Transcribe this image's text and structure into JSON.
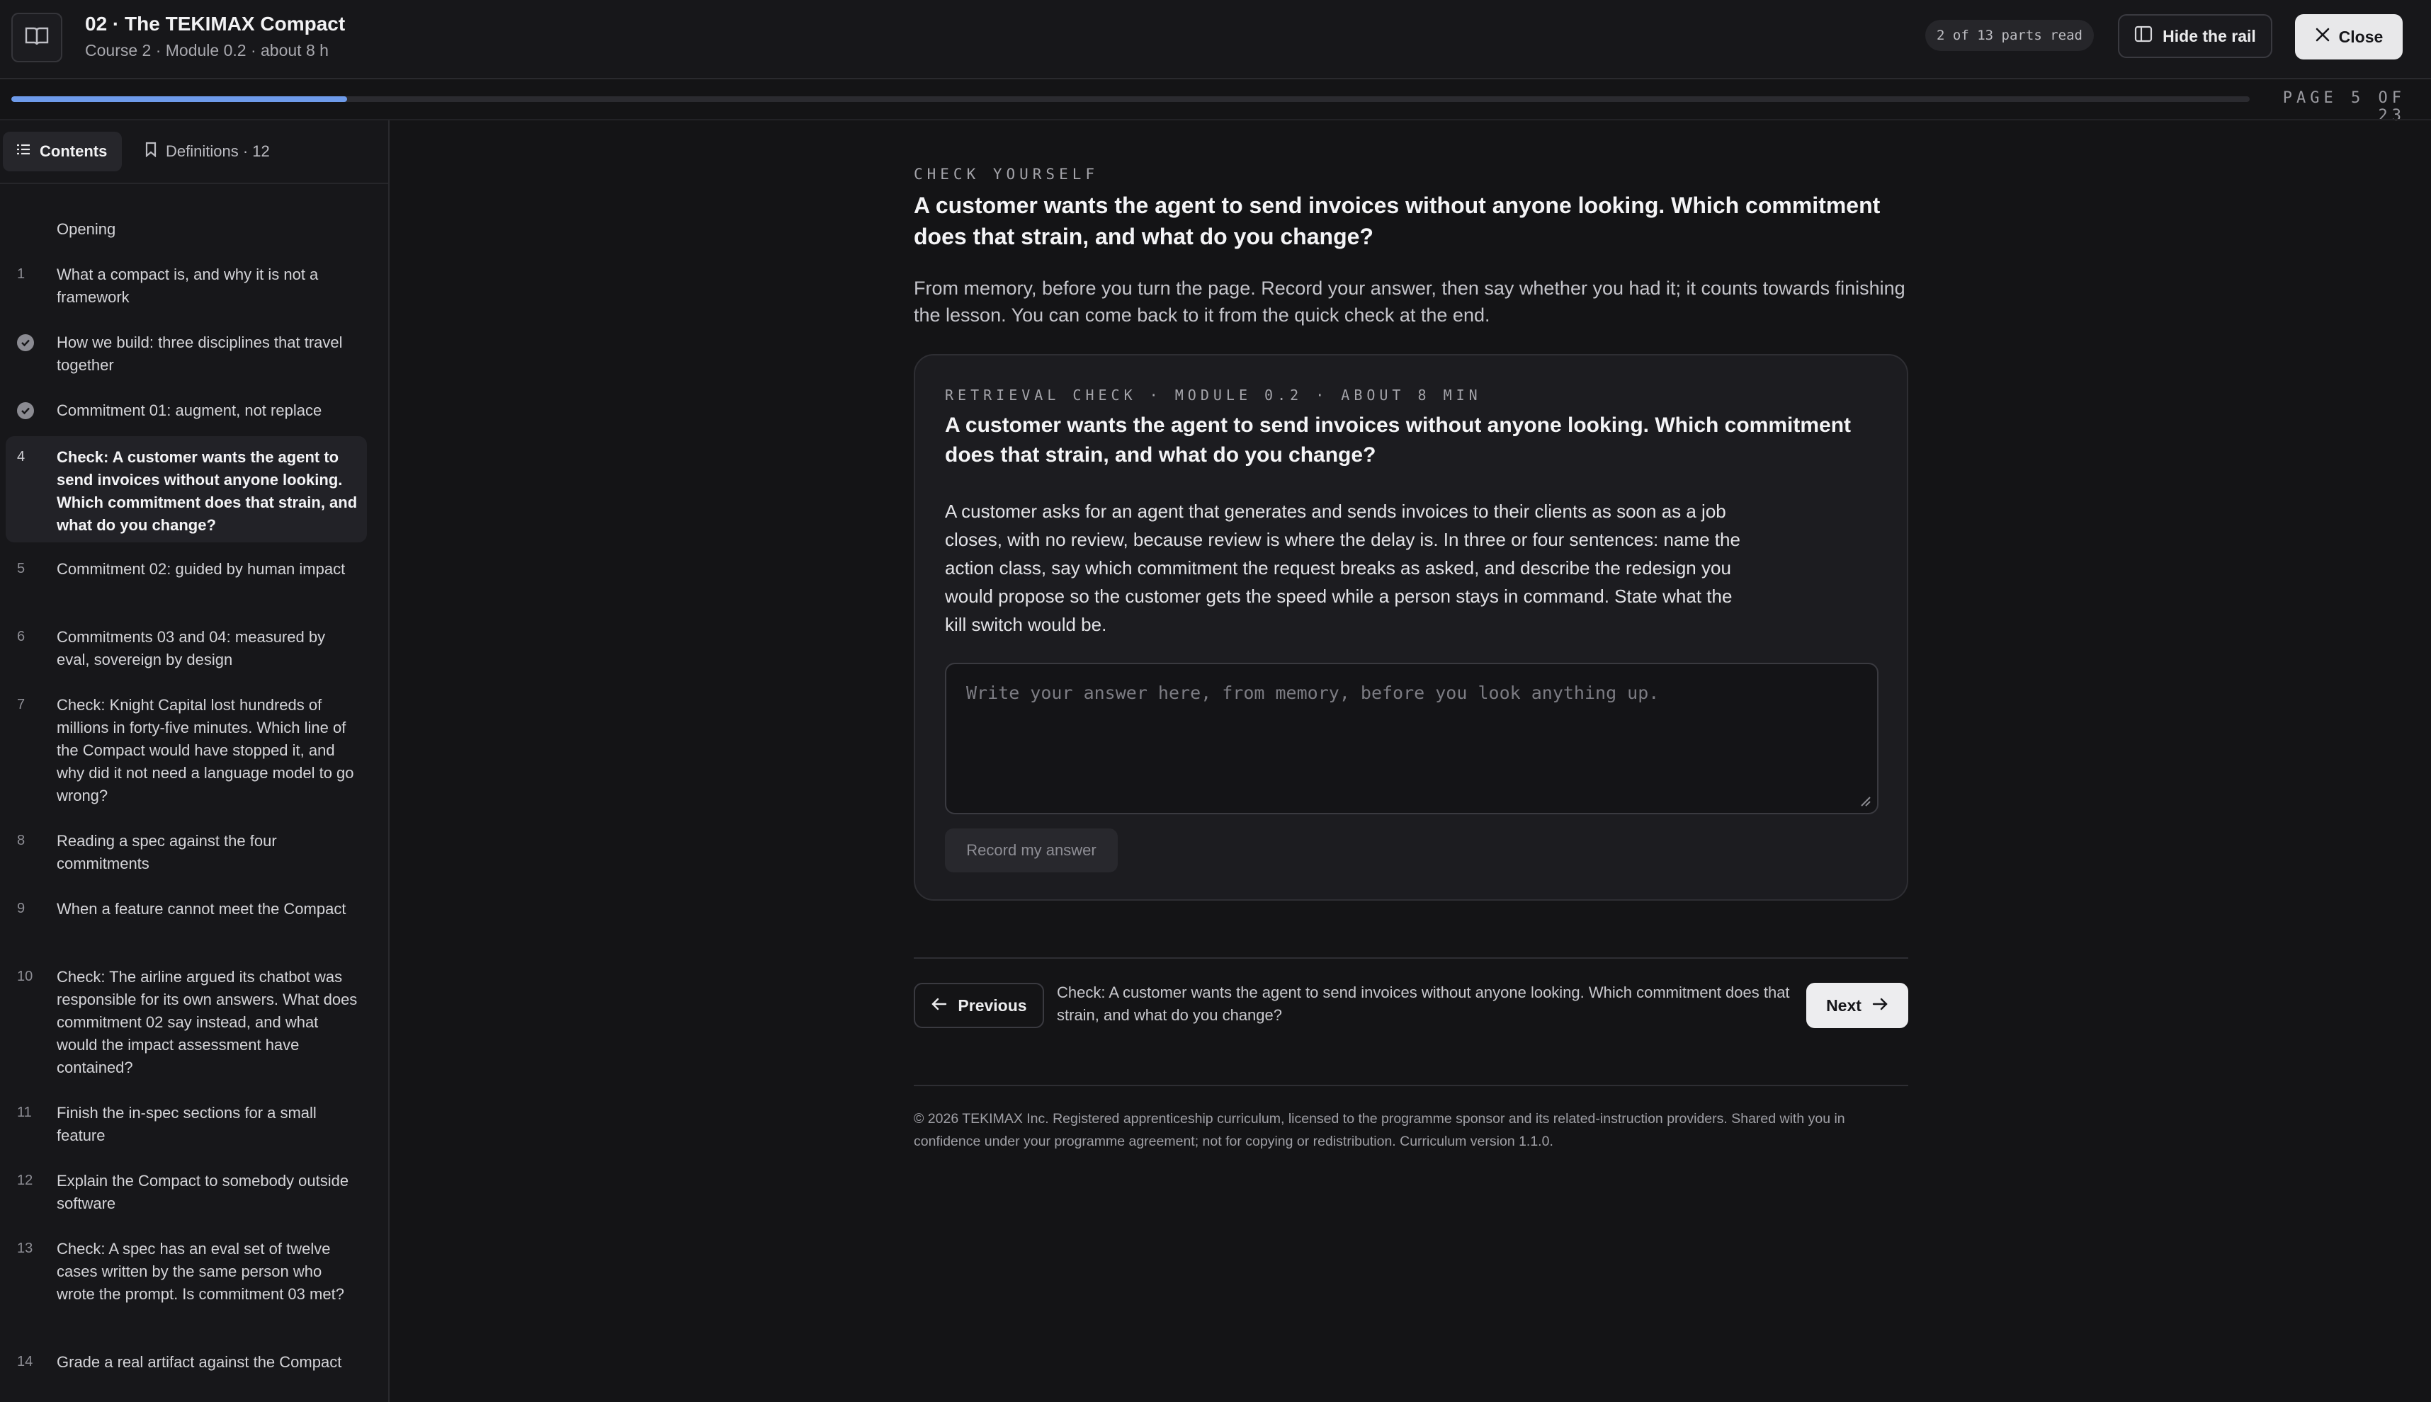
{
  "header": {
    "title": "02 · The TEKIMAX Compact",
    "subtitle": "Course 2 · Module 0.2 · about 8 h",
    "parts_read": "2 of 13 parts read",
    "hide_rail_label": "Hide the rail",
    "close_label": "Close"
  },
  "progress": {
    "fraction": 0.15,
    "page_label": "PAGE 5 OF 23"
  },
  "sidebar": {
    "tabs": [
      {
        "label": "Contents",
        "active": true
      },
      {
        "label": "Definitions · 12",
        "active": false
      }
    ],
    "items": [
      {
        "num": "",
        "label": "Opening",
        "status": "none"
      },
      {
        "num": "1",
        "label": "What a compact is, and why it is not a framework",
        "status": "none"
      },
      {
        "num": "",
        "label": "How we build: three disciplines that travel together",
        "status": "done"
      },
      {
        "num": "",
        "label": "Commitment 01: augment, not replace",
        "status": "done"
      },
      {
        "num": "4",
        "label": "Check: A customer wants the agent to send invoices without anyone looking. Which commitment does that strain, and what do you change?",
        "status": "current"
      },
      {
        "num": "5",
        "label": "Commitment 02: guided by human impact",
        "status": "none"
      },
      {
        "num": "6",
        "label": "Commitments 03 and 04: measured by eval, sovereign by design",
        "status": "none"
      },
      {
        "num": "7",
        "label": "Check: Knight Capital lost hundreds of millions in forty-five minutes. Which line of the Compact would have stopped it, and why did it not need a language model to go wrong?",
        "status": "none"
      },
      {
        "num": "8",
        "label": "Reading a spec against the four commitments",
        "status": "none"
      },
      {
        "num": "9",
        "label": "When a feature cannot meet the Compact",
        "status": "none"
      },
      {
        "num": "10",
        "label": "Check: The airline argued its chatbot was responsible for its own answers. What does commitment 02 say instead, and what would the impact assessment have contained?",
        "status": "none"
      },
      {
        "num": "11",
        "label": "Finish the in-spec sections for a small feature",
        "status": "none"
      },
      {
        "num": "12",
        "label": "Explain the Compact to somebody outside software",
        "status": "none"
      },
      {
        "num": "13",
        "label": "Check: A spec has an eval set of twelve cases written by the same person who wrote the prompt. Is commitment 03 met?",
        "status": "none"
      },
      {
        "num": "14",
        "label": "Grade a real artifact against the Compact",
        "status": "none"
      }
    ]
  },
  "main": {
    "eyebrow": "CHECK YOURSELF",
    "question": "A customer wants the agent to send invoices without anyone looking. Which commitment does that strain, and what do you change?",
    "intro": "From memory, before you turn the page. Record your answer, then say whether you had it; it counts towards finishing the lesson. You can come back to it from the quick check at the end.",
    "card": {
      "eyebrow": "RETRIEVAL CHECK · MODULE 0.2 · ABOUT 8 MIN",
      "question": "A customer wants the agent to send invoices without anyone looking. Which commitment does that strain, and what do you change?",
      "prompt": "A customer asks for an agent that generates and sends invoices to their clients as soon as a job closes, with no review, because review is where the delay is. In three or four sentences: name the action class, say which commitment the request breaks as asked, and describe the redesign you would propose so the customer gets the speed while a person stays in command. State what the kill switch would be.",
      "answer_value": "",
      "answer_placeholder": "Write your answer here, from memory, before you look anything up.",
      "record_label": "Record my answer"
    },
    "nav": {
      "previous_label": "Previous",
      "caption": "Check: A customer wants the agent to send invoices without anyone looking. Which commitment does that strain, and what do you change?",
      "next_label": "Next"
    },
    "footer": "© 2026 TEKIMAX Inc. Registered apprenticeship curriculum, licensed to the programme sponsor and its related-instruction providers. Shared with you in confidence under your programme agreement; not for copying or redistribution. Curriculum version 1.1.0."
  }
}
